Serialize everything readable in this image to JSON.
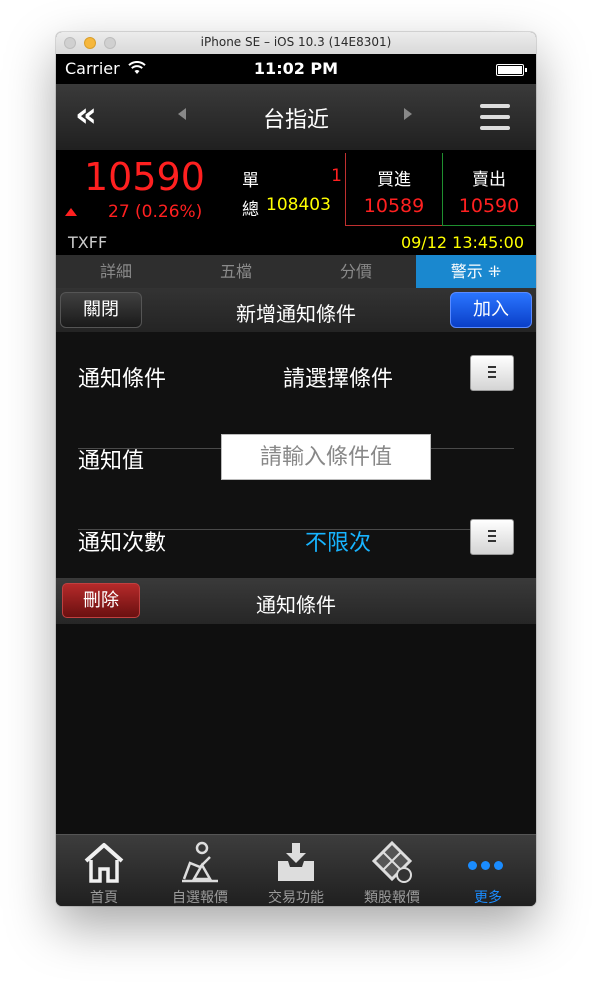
{
  "window": {
    "title": "iPhone SE – iOS 10.3 (14E8301)"
  },
  "status_bar": {
    "carrier": "Carrier",
    "time": "11:02 PM"
  },
  "nav": {
    "back_glyph": "«",
    "title": "台指近"
  },
  "quote": {
    "price": "10590",
    "change": "27",
    "change_pct": "(0.26%)",
    "single_label": "單",
    "single_value": "1",
    "total_label": "總",
    "total_value": "108403",
    "bid_label": "買進",
    "bid_value": "10589",
    "ask_label": "賣出",
    "ask_value": "10590",
    "symbol": "TXFF",
    "datetime": "09/12 13:45:00",
    "up_color": "#ff2020",
    "volume_color": "#ffff00"
  },
  "tabs": [
    {
      "label": "詳細",
      "active": false
    },
    {
      "label": "五檔",
      "active": false
    },
    {
      "label": "分價",
      "active": false
    },
    {
      "label": "警示 ⁜",
      "active": true
    }
  ],
  "toolbar": {
    "close_label": "關閉",
    "title": "新增通知條件",
    "add_label": "加入"
  },
  "form": {
    "condition_label": "通知條件",
    "condition_value": "請選擇條件",
    "value_label": "通知值",
    "value_placeholder": "請輸入條件值",
    "count_label": "通知次數",
    "count_value": "不限次",
    "count_color": "#17b4ff"
  },
  "list_header": {
    "delete_label": "刪除",
    "title": "通知條件"
  },
  "tabbar": [
    {
      "label": "首頁",
      "icon": "home-icon",
      "active": false
    },
    {
      "label": "自選報價",
      "icon": "person-chart-icon",
      "active": false
    },
    {
      "label": "交易功能",
      "icon": "inbox-download-icon",
      "active": false
    },
    {
      "label": "類股報價",
      "icon": "film-coin-icon",
      "active": false
    },
    {
      "label": "更多",
      "icon": "more-dots-icon",
      "active": true
    }
  ]
}
